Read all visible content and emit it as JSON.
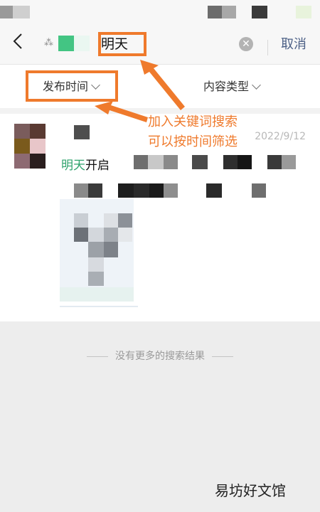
{
  "header": {
    "search_keyword": "明天",
    "cancel_label": "取消"
  },
  "filters": {
    "time_label": "发布时间",
    "type_label": "内容类型"
  },
  "annotation": {
    "line1": "加入关键词搜索",
    "line2": "可以按时间筛选"
  },
  "result": {
    "date": "2022/9/12",
    "keyword": "明天",
    "suffix": "开启"
  },
  "end_message": "没有更多的搜索结果",
  "watermark": "易坊好文馆",
  "colors": {
    "accent_orange": "#ef7a2c",
    "keyword_green": "#2ea36c",
    "cancel_blue": "#4b5f85"
  }
}
